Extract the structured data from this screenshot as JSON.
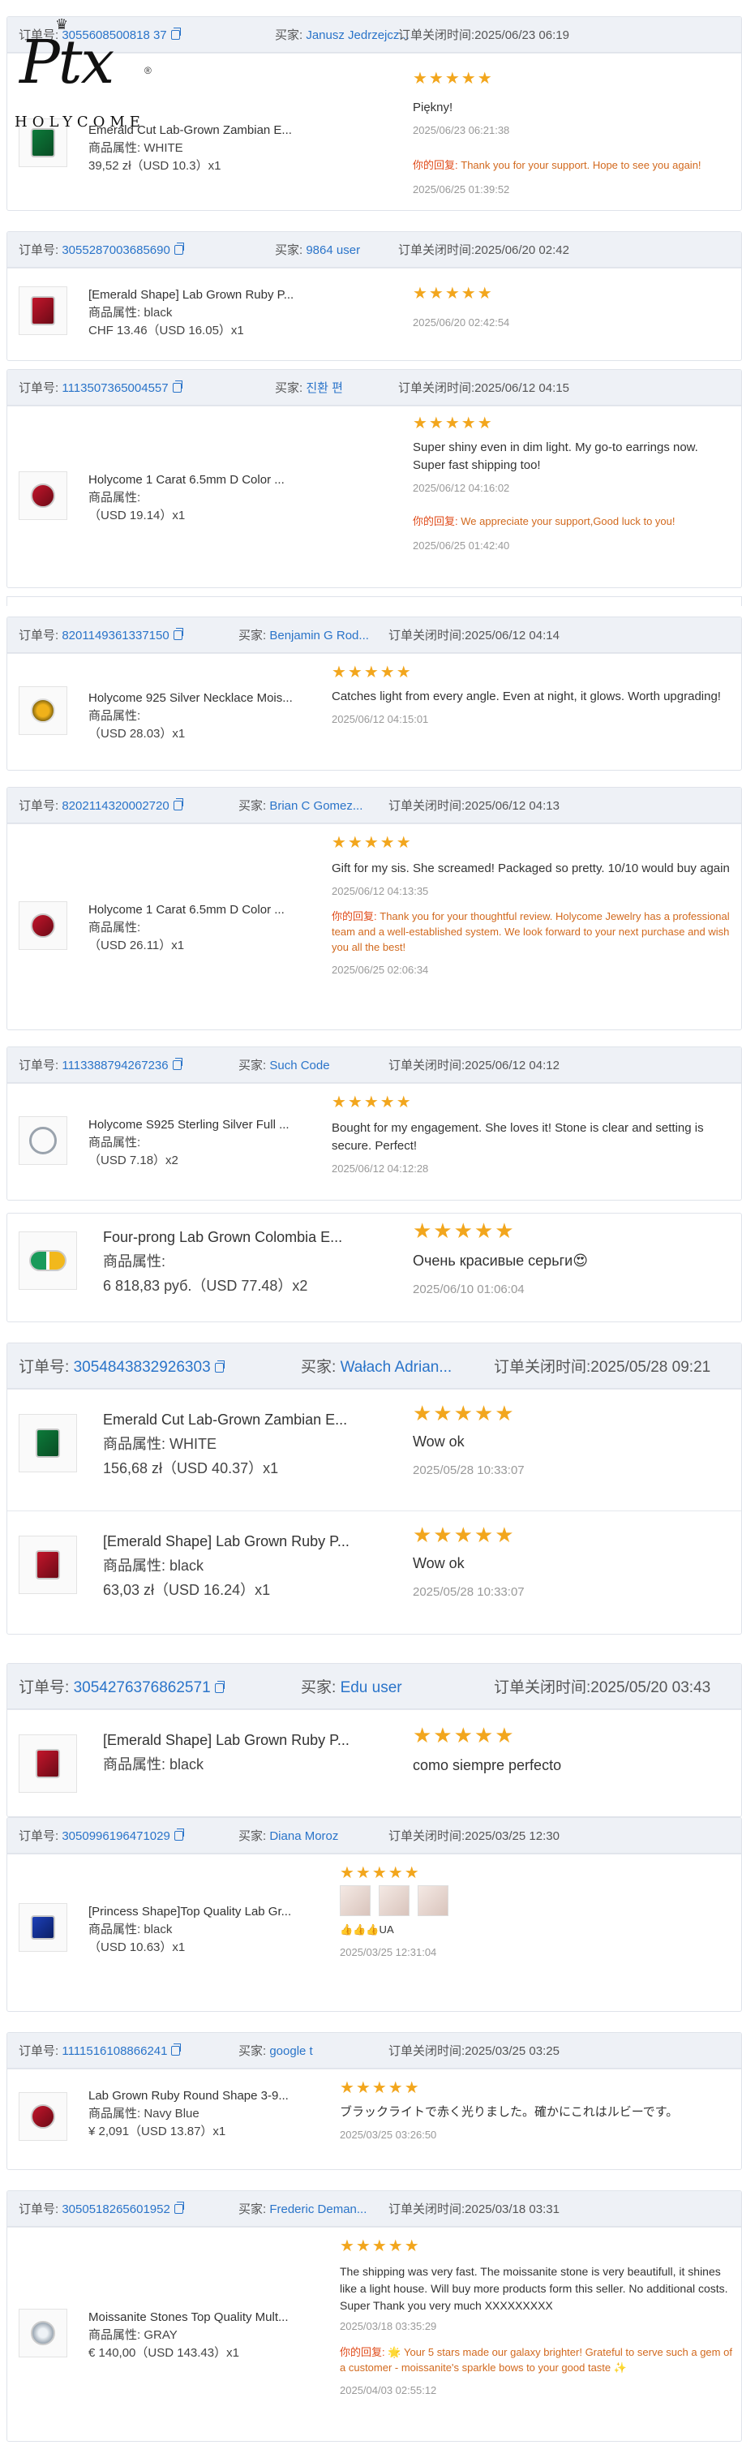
{
  "logo": {
    "text": "Ptx",
    "brand": "HOLYCOME",
    "reg": "®"
  },
  "labels": {
    "order_no": "订单号:",
    "buyer": "买家:",
    "closed": "订单关闭时间:",
    "attr": "商品属性:",
    "reply": "你的回复:"
  },
  "orders": [
    {
      "order_tail": "55608500818 37",
      "order_no": "3055608500818 37",
      "buyer": "Janusz Jedrzejcz...",
      "closed": "2025/06/23 06:19",
      "items": [
        {
          "title": "Emerald Cut Lab-Grown Zambian E...",
          "attr": "WHITE",
          "price": "39,52 zł（USD  10.3）x1",
          "stars": "★★★★★",
          "review": "Piękny!",
          "review_time": "2025/06/23 06:21:38",
          "reply": "Thank you for your support. Hope to see you again!",
          "reply_time": "2025/06/25 01:39:52"
        }
      ]
    },
    {
      "order_no": "3055287003685690",
      "buyer": "9864 user",
      "closed": "2025/06/20 02:42",
      "items": [
        {
          "title": "[Emerald Shape] Lab Grown Ruby P...",
          "attr": "black",
          "price": "CHF 13.46（USD  16.05）x1",
          "stars": "★★★★★",
          "review": "",
          "review_time": "2025/06/20 02:42:54"
        }
      ]
    },
    {
      "order_no": "1113507365004557",
      "buyer": "진환 편",
      "closed": "2025/06/12 04:15",
      "items": [
        {
          "title": "Holycome 1 Carat 6.5mm D Color ...",
          "attr": "",
          "price": "（USD  19.14）x1",
          "stars": "★★★★★",
          "review": "Super shiny even in dim light. My go-to earrings now. Super fast shipping too!",
          "review_time": "2025/06/12 04:16:02",
          "reply": "We appreciate your support,Good luck to you!",
          "reply_time": "2025/06/25 01:42:40"
        }
      ]
    },
    {
      "order_no": "8201149361337150",
      "buyer": "Benjamin G Rod...",
      "closed": "2025/06/12 04:14",
      "items": [
        {
          "title": "Holycome 925 Silver Necklace Mois...",
          "attr": "",
          "price": "（USD  28.03）x1",
          "stars": "★★★★★",
          "review": "Catches light from every angle. Even at night, it glows. Worth upgrading!",
          "review_time": "2025/06/12 04:15:01"
        }
      ]
    },
    {
      "order_no": "8202114320002720",
      "buyer": "Brian C Gomez...",
      "closed": "2025/06/12 04:13",
      "items": [
        {
          "title": "Holycome 1 Carat 6.5mm D Color ...",
          "attr": "",
          "price": "（USD  26.11）x1",
          "stars": "★★★★★",
          "review": "Gift for my sis. She screamed! Packaged so pretty. 10/10 would buy again",
          "review_time": "2025/06/12 04:13:35",
          "reply": "Thank you for your thoughtful review. Holycome Jewelry has a professional team and a well-established system. We look forward to your next purchase and wish you all the best!",
          "reply_time": "2025/06/25 02:06:34"
        }
      ]
    },
    {
      "order_no": "1113388794267236",
      "buyer": "Such Code",
      "closed": "2025/06/12 04:12",
      "items": [
        {
          "title": "Holycome S925 Sterling Silver Full ...",
          "attr": "",
          "price": "（USD  7.18）x2",
          "stars": "★★★★★",
          "review": "Bought for my engagement. She loves it! Stone is clear and setting is secure. Perfect!",
          "review_time": "2025/06/12 04:12:28"
        }
      ]
    },
    {
      "order_no": "",
      "buyer": "",
      "closed": "",
      "items": [
        {
          "title": "Four-prong Lab Grown Colombia E...",
          "attr": "",
          "price": "6 818,83 руб.（USD  77.48）x2",
          "stars": "★★★★★",
          "review": "Очень красивые серьги😍",
          "review_time": "2025/06/10 01:06:04"
        }
      ]
    },
    {
      "order_no": "3054843832926303",
      "buyer": "Wałach Adrian...",
      "closed": "2025/05/28 09:21",
      "items": [
        {
          "title": "Emerald Cut Lab-Grown Zambian E...",
          "attr": "WHITE",
          "price": "156,68 zł（USD  40.37）x1",
          "stars": "★★★★★",
          "review": "Wow ok",
          "review_time": "2025/05/28 10:33:07"
        },
        {
          "title": "[Emerald Shape] Lab Grown Ruby P...",
          "attr": "black",
          "price": "63,03 zł（USD  16.24）x1",
          "stars": "★★★★★",
          "review": "Wow ok",
          "review_time": "2025/05/28 10:33:07"
        }
      ]
    },
    {
      "order_no": "3054276376862571",
      "buyer": "Edu user",
      "closed": "2025/05/20 03:43",
      "items": [
        {
          "title": "[Emerald Shape] Lab Grown Ruby P...",
          "attr": "black",
          "price": "",
          "stars": "★★★★★",
          "review": "como siempre perfecto",
          "review_time": ""
        }
      ]
    },
    {
      "order_no": "3050996196471029",
      "buyer": "Diana Moroz",
      "closed": "2025/03/25 12:30",
      "items": [
        {
          "title": "[Princess Shape]Top Quality Lab Gr...",
          "attr": "black",
          "price": "（USD  10.63）x1",
          "stars": "★★★★★",
          "review": "👍👍👍UA",
          "review_time": "2025/03/25 12:31:04"
        }
      ]
    },
    {
      "order_no": "1111516108866241",
      "buyer": "google t",
      "closed": "2025/03/25 03:25",
      "items": [
        {
          "title": "Lab Grown Ruby Round Shape 3-9...",
          "attr": "Navy Blue",
          "price": "¥ 2,091（USD  13.87）x1",
          "stars": "★★★★★",
          "review": "ブラックライトで赤く光りました。確かにこれはルビーです。",
          "review_time": "2025/03/25 03:26:50"
        }
      ]
    },
    {
      "order_no": "3050518265601952",
      "buyer": "Frederic Deman...",
      "closed": "2025/03/18 03:31",
      "items": [
        {
          "title": "Moissanite Stones Top Quality Mult...",
          "attr": "GRAY",
          "price": "€ 140,00（USD  143.43）x1",
          "stars": "★★★★★",
          "review": "The shipping was very fast. The moissanite stone is very beautifull, it shines like a light house. Will buy more products form this seller. No additional costs. Super Thank you very much XXXXXXXXX",
          "review_time": "2025/03/18 03:35:29",
          "reply": "🌟 Your 5 stars made our galaxy brighter! Grateful to serve such a gem of a customer - moissanite's sparkle bows to your good taste ✨",
          "reply_time": "2025/04/03 02:55:12"
        }
      ]
    }
  ]
}
